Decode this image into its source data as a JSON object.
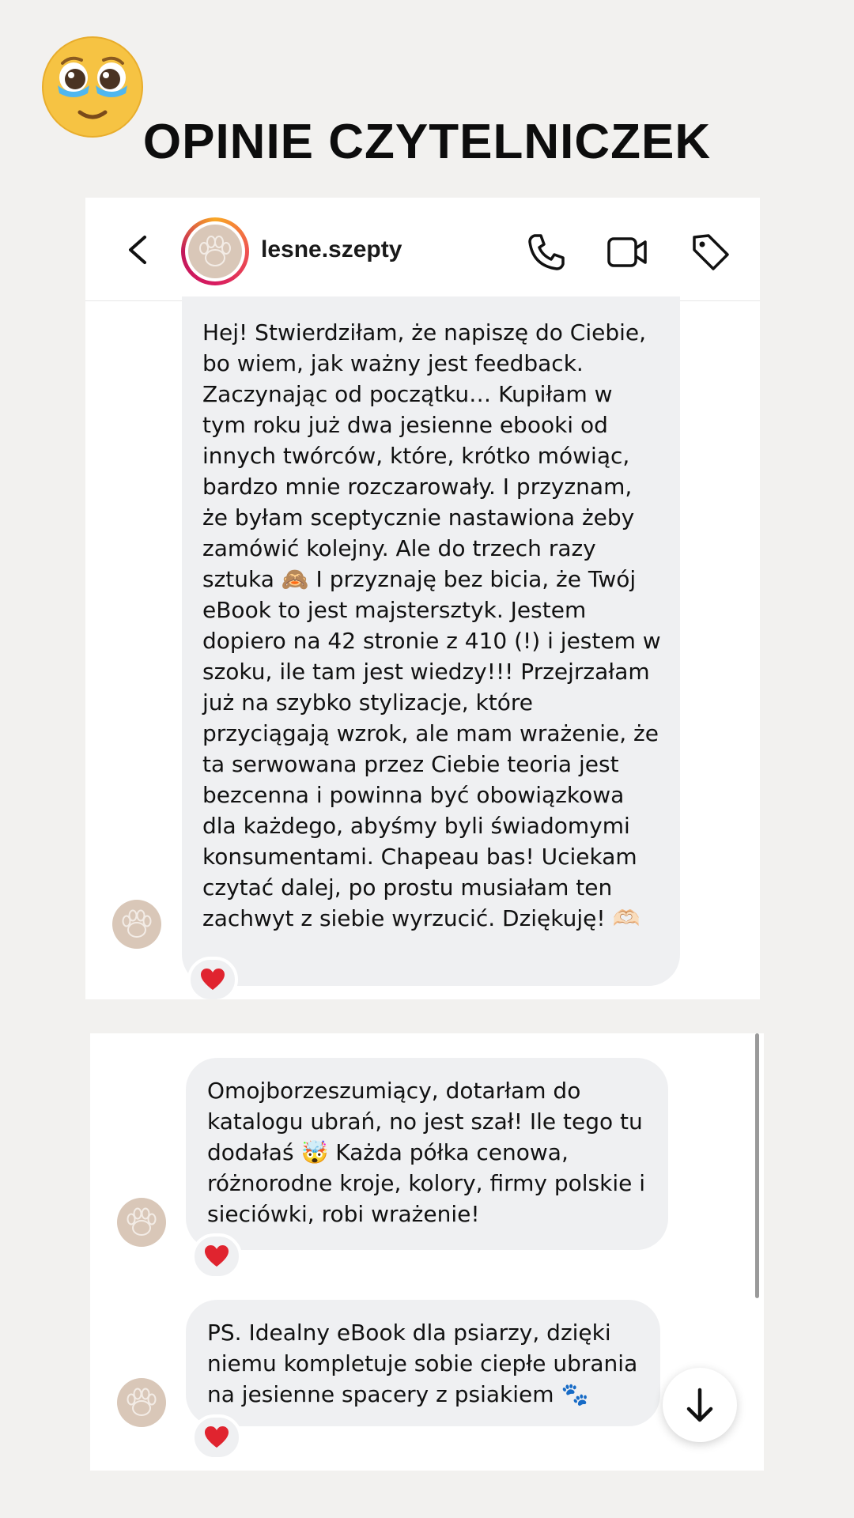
{
  "page": {
    "title": "OPINIE CZYTELNICZEK",
    "emoji_icon": "face-holding-back-tears-icon",
    "background_color": "#f2f1ef"
  },
  "dm_header": {
    "username": "lesne.szepty",
    "icons": [
      "back-icon",
      "phone-icon",
      "video-camera-icon",
      "tag-icon"
    ],
    "story_ring_colors": [
      "#f9a825",
      "#ef5350",
      "#d81b60"
    ]
  },
  "messages": [
    {
      "text": "Hej! Stwierdziłam, że napiszę do Ciebie,\nbo wiem, jak ważny jest feedback.\nZaczynając od początku… Kupiłam w\ntym roku już dwa jesienne ebooki od\ninnych twórców, które, krótko mówiąc,\nbardzo mnie rozczarowały. I przyznam,\nże byłam sceptycznie nastawiona żeby\nzamówić kolejny. Ale do trzech razy\nsztuka 🙈 I przyznaję bez bicia, że Twój\neBook to jest majstersztyk. Jestem\ndopiero na 42 stronie z 410 (!) i jestem w\nszoku, ile tam jest wiedzy!!! Przejrzałam\njuż na szybko stylizacje, które\nprzyciągają wzrok, ale mam wrażenie, że\nta serwowana przez Ciebie teoria jest\nbezcenna i powinna być obowiązkowa\ndla każdego, abyśmy byli świadomymi\nkonsumentami. Chapeau bas! Uciekam\nczytać dalej, po prostu musiałam ten\nzachwyt z siebie wyrzucić. Dziękuję! 🫶🏻",
      "reaction": "red-heart-icon"
    },
    {
      "text": "Omojborzeszumiący, dotarłam do\nkatalogu ubrań, no jest szał! Ile tego tu\ndodałaś 🤯 Każda półka cenowa,\nróżnorodne kroje, kolory, firmy polskie i\nsieciówki, robi wrażenie!",
      "reaction": "red-heart-icon"
    },
    {
      "text": "PS. Idealny eBook dla psiarzy, dzięki\nniemu kompletuje sobie ciepłe ubrania\nna jesienne spacery z psiakiem 🐾",
      "reaction": "red-heart-icon"
    }
  ],
  "controls": {
    "scroll_down_icon": "arrow-down-icon"
  },
  "colors": {
    "bubble": "#eff0f2",
    "heart": "#e0242f",
    "avatar": "#d9c7b8"
  }
}
